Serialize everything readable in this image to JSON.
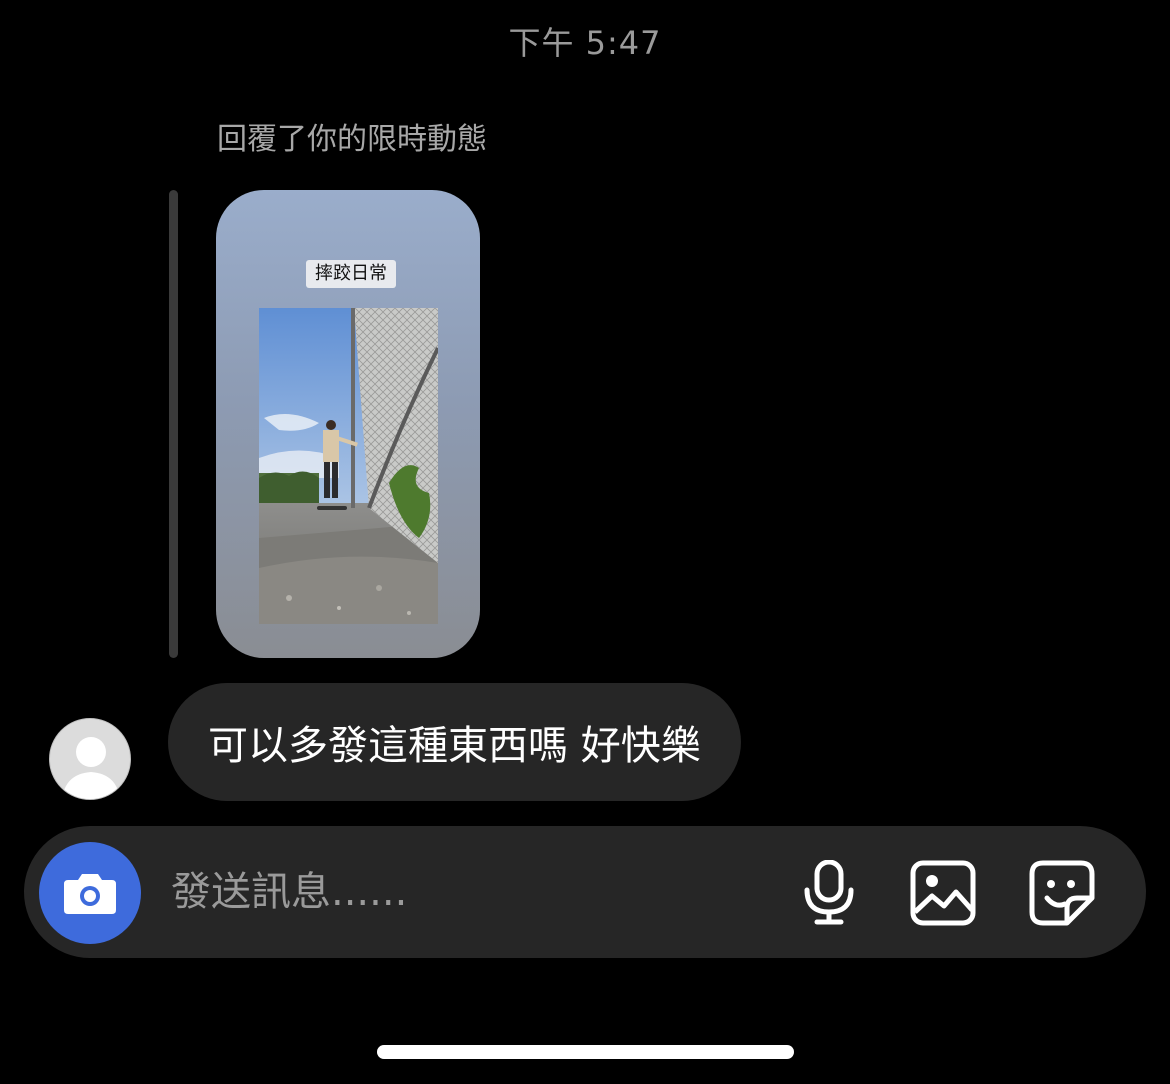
{
  "timestamp": "下午 5:47",
  "reply": {
    "label": "回覆了你的限時動態",
    "story_caption": "摔跤日常"
  },
  "message": {
    "text": "可以多發這種東西嗎 好快樂"
  },
  "composer": {
    "placeholder": "發送訊息......",
    "icons": [
      "camera-icon",
      "microphone-icon",
      "gallery-icon",
      "sticker-icon"
    ],
    "camera_button_color": "#3e6bdc"
  }
}
